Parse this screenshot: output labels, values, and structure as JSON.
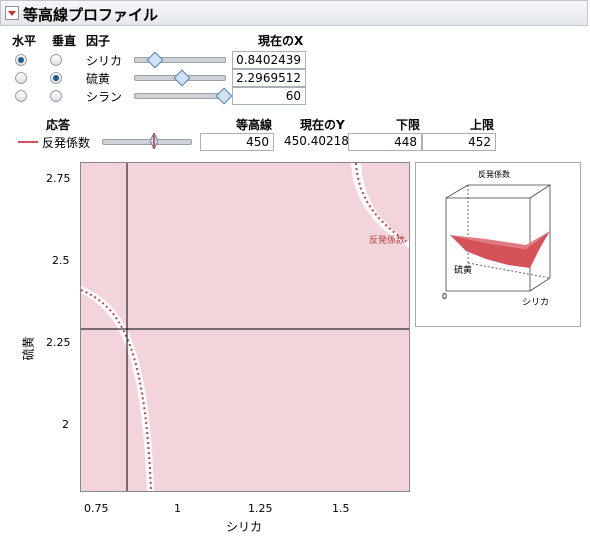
{
  "title": "等高線プロファイル",
  "headers": {
    "horizontal": "水平",
    "vertical": "垂直",
    "factor": "因子",
    "current_x": "現在のX"
  },
  "factors": [
    {
      "name": "シリカ",
      "value": "0.8402439",
      "h_selected": true,
      "v_selected": false,
      "slider": 0.18
    },
    {
      "name": "硫黄",
      "value": "2.2969512",
      "h_selected": false,
      "v_selected": true,
      "slider": 0.5
    },
    {
      "name": "シラン",
      "value": "60",
      "h_selected": false,
      "v_selected": false,
      "slider": 1.0
    }
  ],
  "response_headers": {
    "response": "応答",
    "contour": "等高線",
    "current_y": "現在のY",
    "lower": "下限",
    "upper": "上限"
  },
  "response": {
    "name": "反発係数",
    "contour": "450",
    "current_y": "450.40218",
    "lower": "448",
    "upper": "452",
    "slider": 0.5,
    "color": "#d6525b"
  },
  "plot": {
    "xlabel": "シリカ",
    "ylabel": "硫黄",
    "xticks": [
      "0.75",
      "1",
      "1.25",
      "1.5"
    ],
    "yticks": [
      "2.75",
      "2.5",
      "2.25",
      "2"
    ],
    "contour_label": "反発係数",
    "fill": "#f2d4da"
  },
  "surface": {
    "title": "反発係数",
    "axis_y": "硫黄",
    "axis_x": "シリカ",
    "axis_origin": "0",
    "color": "#d6525b"
  }
}
